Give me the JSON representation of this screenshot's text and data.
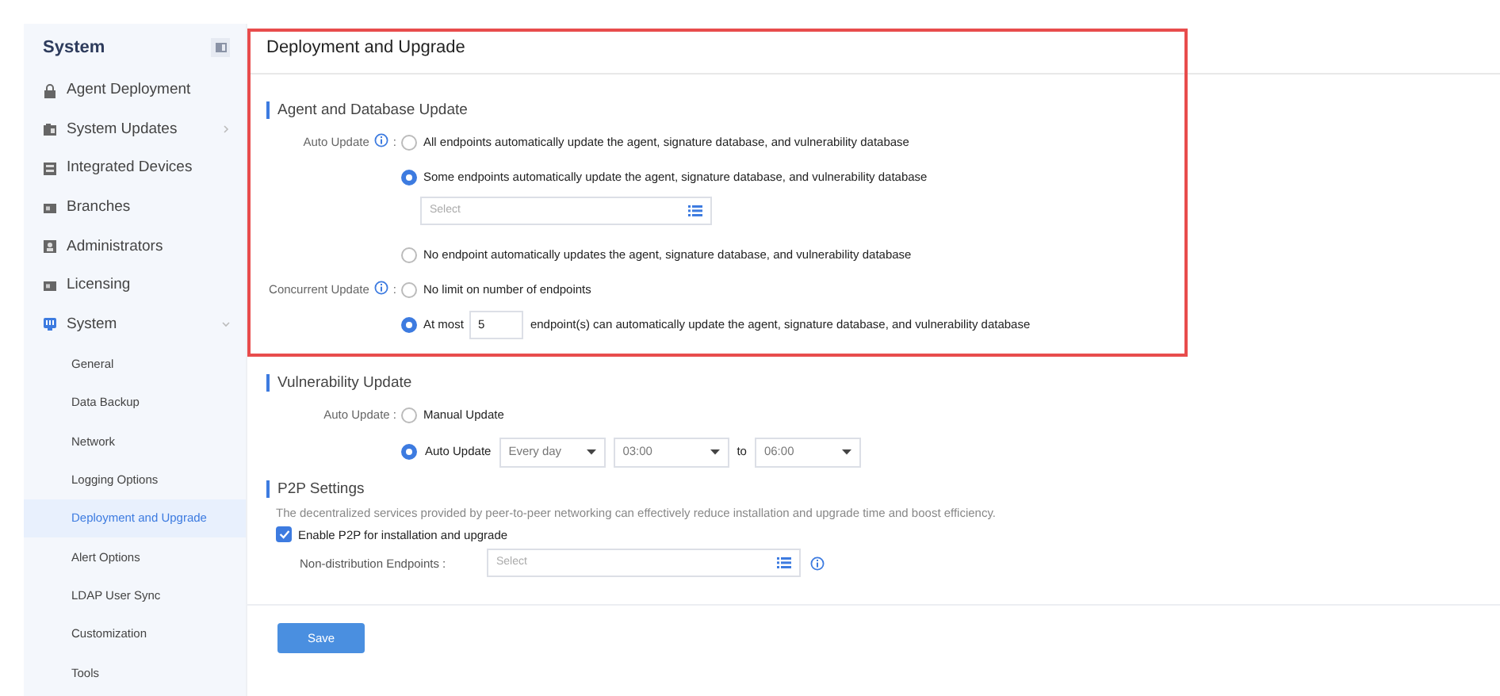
{
  "sidebar": {
    "title": "System",
    "items": [
      {
        "label": "Agent Deployment"
      },
      {
        "label": "System Updates",
        "expanded": false
      },
      {
        "label": "Integrated Devices"
      },
      {
        "label": "Branches"
      },
      {
        "label": "Administrators"
      },
      {
        "label": "Licensing"
      },
      {
        "label": "System",
        "expanded": true,
        "children": [
          {
            "label": "General",
            "selected": false
          },
          {
            "label": "Data Backup",
            "selected": false
          },
          {
            "label": "Network",
            "selected": false
          },
          {
            "label": "Logging Options",
            "selected": false
          },
          {
            "label": "Deployment and Upgrade",
            "selected": true
          },
          {
            "label": "Alert Options",
            "selected": false
          },
          {
            "label": "LDAP User Sync",
            "selected": false
          },
          {
            "label": "Customization",
            "selected": false
          },
          {
            "label": "Tools",
            "selected": false
          }
        ]
      }
    ]
  },
  "main": {
    "title": "Deployment and Upgrade",
    "highlight": true,
    "sections": [
      {
        "kind": "fields",
        "title": "Agent and Database Update",
        "fields": [
          {
            "label": "Auto Update",
            "info": true,
            "suffix": ":",
            "options": [
              {
                "kind": "plain",
                "label": "All endpoints automatically update the agent, signature database, and vulnerability database",
                "selected": false
              },
              {
                "kind": "with_select",
                "label": "Some endpoints automatically update the agent, signature database, and vulnerability database",
                "selected": true,
                "placeholder": "Select"
              },
              {
                "kind": "plain",
                "label": "No endpoint automatically updates the agent, signature database, and vulnerability database",
                "selected": false
              }
            ]
          },
          {
            "label": "Concurrent Update",
            "info": true,
            "suffix": ":",
            "options": [
              {
                "kind": "plain",
                "label": "No limit on number of endpoints",
                "selected": false
              },
              {
                "kind": "count",
                "label": "At most",
                "count": "5",
                "suffix_text": "endpoint(s) can automatically update the agent, signature database, and vulnerability database",
                "selected": true
              }
            ]
          }
        ]
      },
      {
        "kind": "fields",
        "title": "Vulnerability Update",
        "fields": [
          {
            "label": "Auto Update :",
            "options": [
              {
                "kind": "plain",
                "label": "Manual Update",
                "selected": false
              },
              {
                "kind": "schedule",
                "label": "Auto Update",
                "selected": true,
                "frequency": "Every day",
                "start": "03:00",
                "joiner": "to",
                "end": "06:00"
              }
            ]
          }
        ]
      },
      {
        "kind": "p2p",
        "title": "P2P Settings",
        "description": "The decentralized services provided by peer-to-peer networking can effectively reduce installation and upgrade time and boost efficiency.",
        "checkbox": {
          "label": "Enable P2P for installation and upgrade",
          "checked": true
        },
        "field": {
          "label": "Non-distribution Endpoints :",
          "placeholder": "Select",
          "info": true
        }
      }
    ],
    "save": "Save"
  }
}
